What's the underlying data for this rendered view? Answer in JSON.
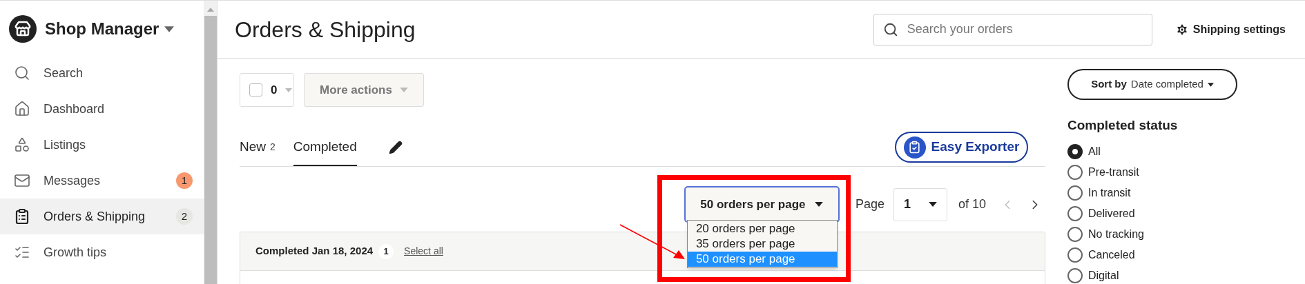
{
  "sidebar": {
    "shop_name": "Shop Manager",
    "items": [
      {
        "label": "Search",
        "selected": false
      },
      {
        "label": "Dashboard",
        "selected": false
      },
      {
        "label": "Listings",
        "selected": false
      },
      {
        "label": "Messages",
        "selected": false,
        "badge": "1",
        "color": "#f7986f"
      },
      {
        "label": "Orders & Shipping",
        "selected": true,
        "badge": "2",
        "color": "#e6e6e3"
      },
      {
        "label": "Growth tips",
        "selected": false
      }
    ]
  },
  "header": {
    "title": "Orders & Shipping",
    "search": {
      "placeholder": "Search your orders"
    },
    "settings": "Shipping settings"
  },
  "toolbar": {
    "checked": false,
    "count": "0",
    "more_actions": {
      "label": "More actions",
      "disabled": true
    }
  },
  "tabs": [
    {
      "label": "New",
      "count": "2",
      "selected": false
    },
    {
      "label": "Completed",
      "selected": true
    }
  ],
  "exporter": "Easy Exporter",
  "per_page": {
    "value": "50 orders per page",
    "expanded": true,
    "options": [
      {
        "label": "20 orders per page",
        "selected": false
      },
      {
        "label": "35 orders per page",
        "selected": false
      },
      {
        "label": "50 orders per page",
        "selected": true
      }
    ]
  },
  "pagination": {
    "label": "Page",
    "page": "1",
    "total": "of 10",
    "prev_disabled": true
  },
  "group": {
    "title": "Completed Jan 18, 2024",
    "count": "1",
    "select_all": "Select all"
  },
  "sort": {
    "label": "Sort by",
    "value": "Date completed"
  },
  "filter": {
    "title": "Completed status",
    "options": [
      {
        "label": "All",
        "selected": true
      },
      {
        "label": "Pre-transit",
        "selected": false
      },
      {
        "label": "In transit",
        "selected": false
      },
      {
        "label": "Delivered",
        "selected": false
      },
      {
        "label": "No tracking",
        "selected": false
      },
      {
        "label": "Canceled",
        "selected": false
      },
      {
        "label": "Digital",
        "selected": false
      }
    ]
  }
}
